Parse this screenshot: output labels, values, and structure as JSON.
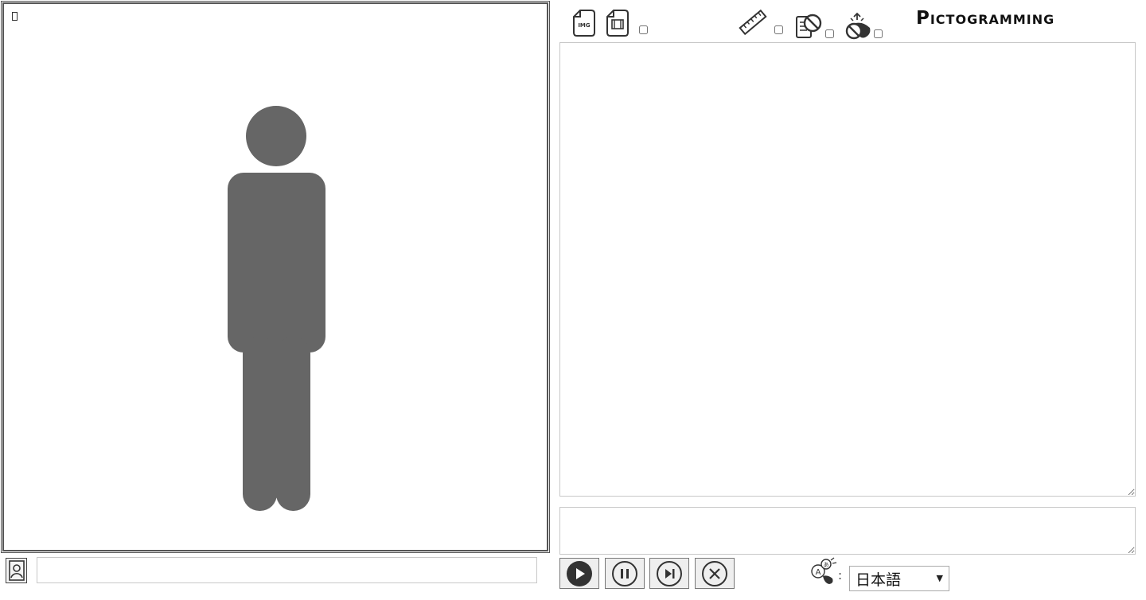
{
  "app": {
    "title": "Pictogramming"
  },
  "stage": {
    "figure": "person-pictogram",
    "figure_color": "#666666"
  },
  "toolbar": {
    "icons": [
      "save-image-icon",
      "save-animation-icon",
      "ruler-icon",
      "no-script-icon",
      "no-touch-icon"
    ],
    "checkboxes": {
      "animation": false,
      "ruler": false,
      "no_script": false,
      "no_touch": false
    }
  },
  "editor": {
    "code": "",
    "console": ""
  },
  "footer": {
    "title_input_value": "",
    "controls": [
      "play-icon",
      "pause-icon",
      "step-icon",
      "stop-icon"
    ]
  },
  "language": {
    "selected": "日本語",
    "icon": "language-icon"
  }
}
